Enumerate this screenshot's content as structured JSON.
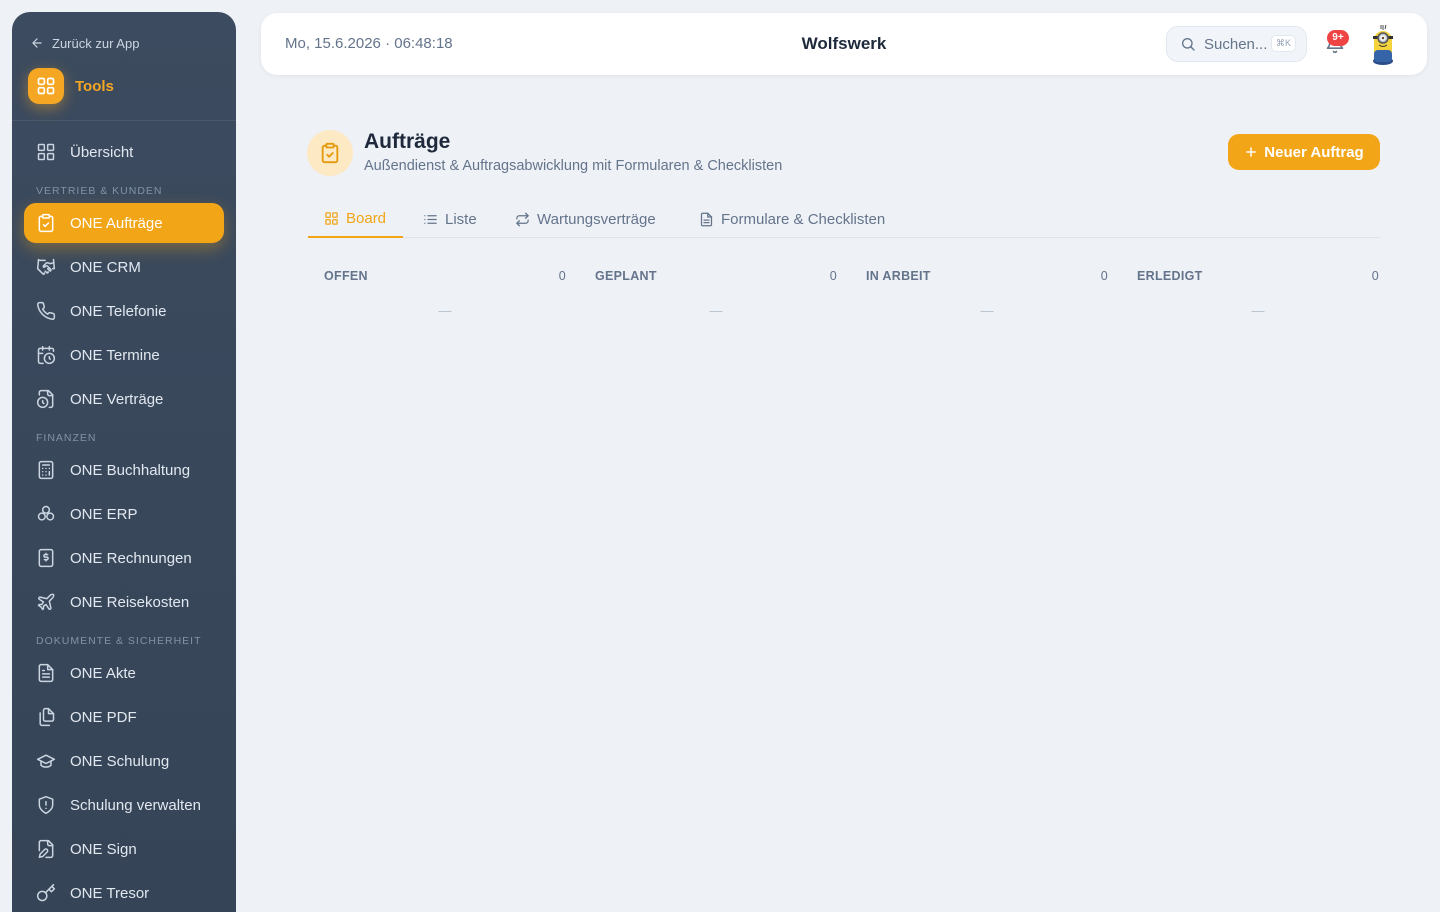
{
  "sidebar": {
    "back_label": "Zurück zur App",
    "tools_label": "Tools",
    "items": [
      {
        "type": "item",
        "label": "Übersicht",
        "icon": "grid-icon"
      },
      {
        "type": "section",
        "label": "VERTRIEB & KUNDEN"
      },
      {
        "type": "item",
        "label": "ONE Aufträge",
        "icon": "clipboard-check-icon",
        "active": true
      },
      {
        "type": "item",
        "label": "ONE CRM",
        "icon": "handshake-icon"
      },
      {
        "type": "item",
        "label": "ONE Telefonie",
        "icon": "phone-icon"
      },
      {
        "type": "item",
        "label": "ONE Termine",
        "icon": "calendar-clock-icon"
      },
      {
        "type": "item",
        "label": "ONE Verträge",
        "icon": "file-clock-icon"
      },
      {
        "type": "section",
        "label": "FINANZEN"
      },
      {
        "type": "item",
        "label": "ONE Buchhaltung",
        "icon": "calculator-icon"
      },
      {
        "type": "item",
        "label": "ONE ERP",
        "icon": "boxes-icon"
      },
      {
        "type": "item",
        "label": "ONE Rechnungen",
        "icon": "receipt-dollar-icon"
      },
      {
        "type": "item",
        "label": "ONE Reisekosten",
        "icon": "plane-icon"
      },
      {
        "type": "section",
        "label": "DOKUMENTE & SICHERHEIT"
      },
      {
        "type": "item",
        "label": "ONE Akte",
        "icon": "file-text-icon"
      },
      {
        "type": "item",
        "label": "ONE PDF",
        "icon": "files-icon"
      },
      {
        "type": "item",
        "label": "ONE Schulung",
        "icon": "graduation-cap-icon"
      },
      {
        "type": "item",
        "label": "Schulung verwalten",
        "icon": "shield-icon"
      },
      {
        "type": "item",
        "label": "ONE Sign",
        "icon": "file-pen-icon"
      },
      {
        "type": "item",
        "label": "ONE Tresor",
        "icon": "key-icon"
      }
    ]
  },
  "topbar": {
    "datetime": "Mo, 15.6.2026 · 06:48:18",
    "brand": "Wolfswerk",
    "search_placeholder": "Suchen...",
    "search_shortcut": "⌘K",
    "notification_badge": "9+"
  },
  "page": {
    "title": "Aufträge",
    "subtitle": "Außendienst & Auftragsabwicklung mit Formularen & Checklisten",
    "new_button": "Neuer Auftrag"
  },
  "tabs": [
    {
      "label": "Board",
      "icon": "grid-icon",
      "active": true
    },
    {
      "label": "Liste",
      "icon": "list-icon"
    },
    {
      "label": "Wartungsverträge",
      "icon": "repeat-icon"
    },
    {
      "label": "Formulare & Checklisten",
      "icon": "file-text-icon"
    }
  ],
  "board": {
    "columns": [
      {
        "title": "OFFEN",
        "count": "0",
        "empty": "—"
      },
      {
        "title": "GEPLANT",
        "count": "0",
        "empty": "—"
      },
      {
        "title": "IN ARBEIT",
        "count": "0",
        "empty": "—"
      },
      {
        "title": "ERLEDIGT",
        "count": "0",
        "empty": "—"
      }
    ]
  },
  "colors": {
    "accent": "#f2a516",
    "sidebar_bg": "#3c4b5f",
    "badge": "#ef4444"
  }
}
